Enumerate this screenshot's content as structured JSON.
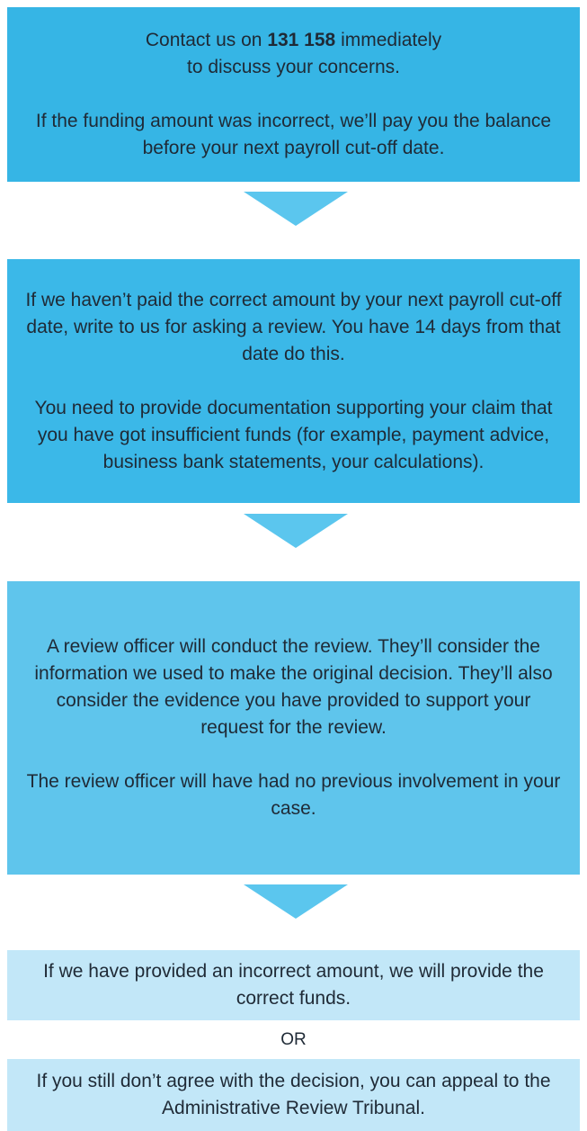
{
  "colors": {
    "box1": "#36b5e5",
    "box2": "#3bb8e8",
    "box3": "#5fc5ec",
    "box_light": "#c2e7f8",
    "arrow": "#5bc6ee",
    "text": "#1f2a36"
  },
  "step1": {
    "line1_pre": "Contact us on ",
    "line1_phone": "131 158",
    "line1_post": " immediately",
    "line2": "to discuss your concerns.",
    "para2": "If the funding amount was incorrect, we’ll pay you the balance before your next payroll cut-off date."
  },
  "step2": {
    "para1": "If we haven’t paid the correct amount by your next payroll cut-off date, write to us for asking a review. You have 14 days from that date do this.",
    "para2": "You need to provide documentation supporting your claim that you have got insufficient funds (for example, payment advice, business bank statements, your calculations)."
  },
  "step3": {
    "para1": "A review officer will conduct the review. They’ll consider the information we used to make the original decision. They’ll also consider the evidence you have provided to support your request for the review.",
    "para2": "The review officer will have had no previous involvement in your case."
  },
  "outcome1": "If we have provided an incorrect amount, we will provide the correct funds.",
  "or_label": "OR",
  "outcome2": "If you still don’t agree with the decision, you can appeal to the Administrative Review Tribunal."
}
